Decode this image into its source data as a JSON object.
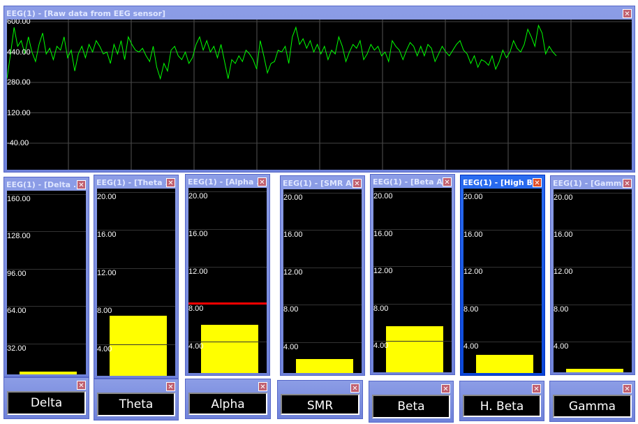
{
  "raw_window": {
    "title": "EEG(1) - [Raw data from EEG sensor]",
    "close": "✕",
    "line_color": "#00ff00",
    "chart_data": {
      "type": "line",
      "ylim": [
        -120,
        620
      ],
      "yticks": [
        "600.00",
        "440.00",
        "280.00",
        "120.00",
        "-40.00"
      ],
      "ytick_values": [
        600,
        440,
        280,
        120,
        -40
      ],
      "grid": true,
      "values": [
        300,
        430,
        570,
        470,
        500,
        430,
        520,
        440,
        390,
        480,
        540,
        430,
        460,
        400,
        470,
        450,
        520,
        410,
        450,
        340,
        430,
        470,
        410,
        480,
        440,
        500,
        470,
        430,
        440,
        380,
        480,
        430,
        500,
        400,
        520,
        480,
        450,
        440,
        460,
        420,
        390,
        470,
        360,
        300,
        380,
        340,
        450,
        470,
        420,
        400,
        440,
        380,
        410,
        480,
        520,
        450,
        500,
        440,
        470,
        410,
        480,
        390,
        300,
        400,
        380,
        420,
        390,
        450,
        430,
        400,
        350,
        500,
        420,
        330,
        380,
        390,
        450,
        440,
        470,
        380,
        520,
        570,
        480,
        510,
        460,
        500,
        440,
        480,
        430,
        470,
        400,
        450,
        430,
        520,
        470,
        390,
        440,
        480,
        460,
        500,
        400,
        430,
        480,
        450,
        470,
        420,
        440,
        390,
        500,
        470,
        450,
        400,
        450,
        490,
        470,
        420,
        470,
        420,
        480,
        460,
        390,
        430,
        470,
        440,
        420,
        450,
        480,
        500,
        450,
        430,
        380,
        420,
        360,
        400,
        390,
        370,
        420,
        350,
        390,
        450,
        410,
        440,
        500,
        460,
        440,
        480,
        560,
        520,
        470,
        580,
        540,
        430,
        470,
        440,
        420
      ]
    }
  },
  "band_windows": [
    {
      "title": "EEG(1) - [Delta ...",
      "close": "✕",
      "label": "Delta",
      "ticks": [
        "160.00",
        "128.00",
        "96.00",
        "64.00",
        "32.00"
      ],
      "max": 160,
      "value": 8,
      "active": false
    },
    {
      "title": "EEG(1) - [Theta ...",
      "close": "✕",
      "label": "Theta",
      "ticks": [
        "20.00",
        "16.00",
        "12.00",
        "8.00",
        "4.00"
      ],
      "max": 20,
      "value": 7.0,
      "active": false
    },
    {
      "title": "EEG(1) - [Alpha ...",
      "close": "✕",
      "label": "Alpha",
      "ticks": [
        "20.00",
        "16.00",
        "12.00",
        "8.00",
        "4.00"
      ],
      "max": 20,
      "value": 5.8,
      "threshold": 8.1,
      "threshold_color": "#ff0000",
      "active": false
    },
    {
      "title": "EEG(1) - [SMR A...",
      "close": "✕",
      "label": "SMR",
      "ticks": [
        "20.00",
        "16.00",
        "12.00",
        "8.00",
        "4.00"
      ],
      "max": 20,
      "value": 2.2,
      "active": false
    },
    {
      "title": "EEG(1) - [Beta A...",
      "close": "✕",
      "label": "Beta",
      "ticks": [
        "20.00",
        "16.00",
        "12.00",
        "8.00",
        "4.00"
      ],
      "max": 20,
      "value": 5.6,
      "active": false
    },
    {
      "title": "EEG(1) - [High B...",
      "close": "✕",
      "label": "H. Beta",
      "ticks": [
        "20.00",
        "16.00",
        "12.00",
        "8.00",
        "4.00"
      ],
      "max": 20,
      "value": 2.6,
      "active": true
    },
    {
      "title": "EEG(1) - [Gamm...",
      "close": "✕",
      "label": "Gamma",
      "ticks": [
        "20.00",
        "16.00",
        "12.00",
        "8.00",
        "4.00"
      ],
      "max": 20,
      "value": 1.05,
      "active": false
    }
  ],
  "bar_color": "#ffff00"
}
